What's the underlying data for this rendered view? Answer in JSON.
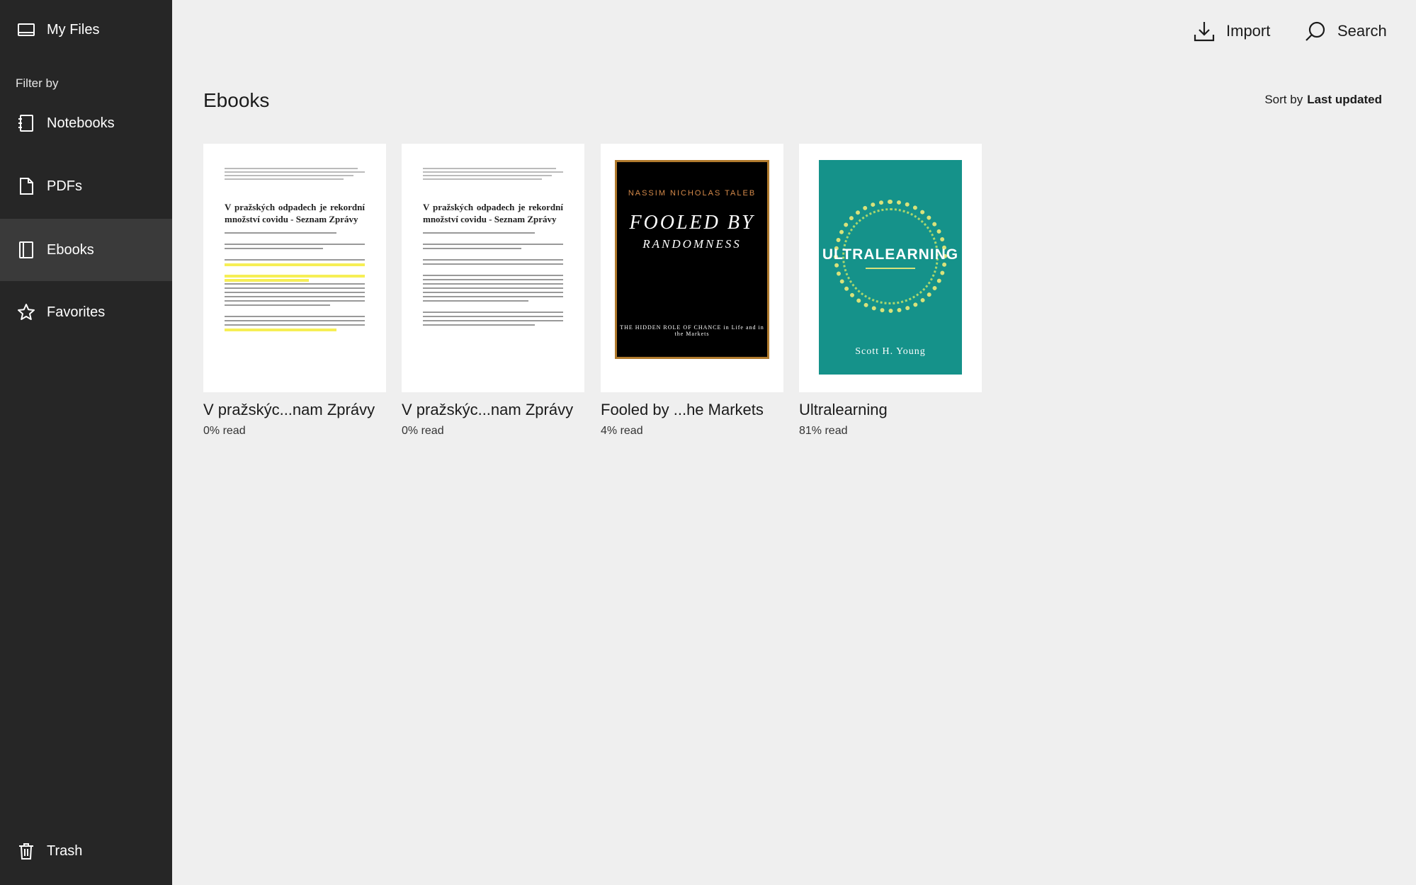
{
  "sidebar": {
    "my_files": "My Files",
    "filter_label": "Filter by",
    "items": [
      {
        "label": "Notebooks",
        "icon": "notebook-icon"
      },
      {
        "label": "PDFs",
        "icon": "pdf-icon"
      },
      {
        "label": "Ebooks",
        "icon": "ebook-icon",
        "active": true
      },
      {
        "label": "Favorites",
        "icon": "star-icon"
      }
    ],
    "trash": "Trash"
  },
  "toolbar": {
    "import_label": "Import",
    "search_label": "Search"
  },
  "main": {
    "title": "Ebooks",
    "sort_label": "Sort by",
    "sort_value": "Last updated",
    "books": [
      {
        "title": "V pražskýc...nam Zprávy",
        "progress": "0% read",
        "cover_heading": "V pražských odpadech je rekordní množství covidu - Seznam Zprávy",
        "highlighted": true
      },
      {
        "title": "V pražskýc...nam Zprávy",
        "progress": "0% read",
        "cover_heading": "V pražských odpadech je rekordní množství covidu - Seznam Zprávy",
        "highlighted": false
      },
      {
        "title": "Fooled by ...he Markets",
        "progress": "4% read",
        "cover_author": "NASSIM NICHOLAS TALEB",
        "cover_title_1": "FOOLED BY",
        "cover_title_2": "RANDOMNESS",
        "cover_subtitle": "THE HIDDEN ROLE OF CHANCE in Life and in the Markets"
      },
      {
        "title": "Ultralearning",
        "progress": "81% read",
        "cover_title": "ULTRALEARNING",
        "cover_author": "Scott H. Young"
      }
    ]
  },
  "colors": {
    "sidebar_bg": "#262626",
    "sidebar_active": "#3a3a3a",
    "page_bg": "#efefef",
    "ultra_cover": "#15928a",
    "highlight": "#f6ef55"
  }
}
